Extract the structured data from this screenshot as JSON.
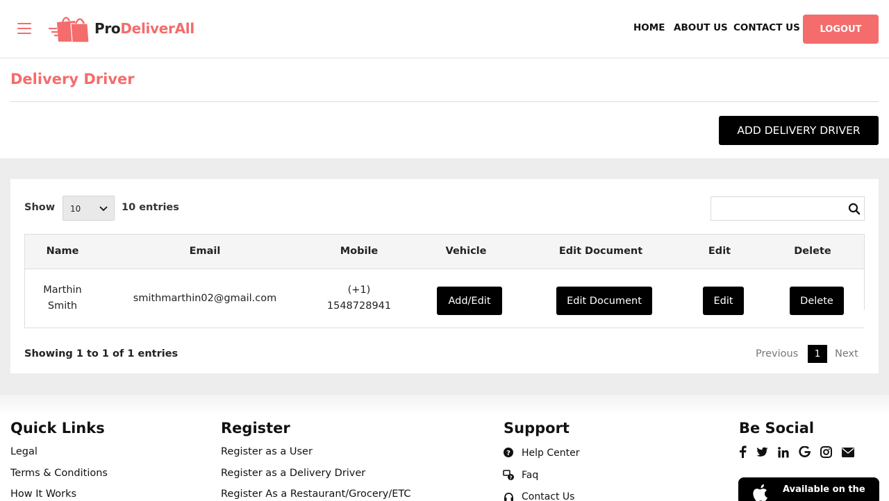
{
  "brand": {
    "name_prefix": "Pro",
    "name_suffix": "DeliverAll",
    "accent": "#f46c6c"
  },
  "nav": {
    "home": "HOME",
    "about": "ABOUT US",
    "contact": "CONTACT US",
    "logout": "LOGOUT"
  },
  "page": {
    "title": "Delivery Driver",
    "add_button": "ADD DELIVERY DRIVER"
  },
  "table_controls": {
    "show_label": "Show",
    "page_size": "10",
    "entries_label": "10 entries",
    "search_placeholder": "",
    "search_value": ""
  },
  "table": {
    "columns": [
      "Name",
      "Email",
      "Mobile",
      "Vehicle",
      "Edit Document",
      "Edit",
      "Delete"
    ],
    "rows": [
      {
        "name_first": "Marthin",
        "name_last": "Smith",
        "email": "smithmarthin02@gmail.com",
        "mobile_code": "(+1)",
        "mobile_number": "1548728941",
        "vehicle_action": "Add/Edit",
        "document_action": "Edit Document",
        "edit_action": "Edit",
        "delete_action": "Delete"
      }
    ]
  },
  "pagination": {
    "info": "Showing 1 to 1 of 1 entries",
    "previous": "Previous",
    "current": "1",
    "next": "Next"
  },
  "footer": {
    "quick_links": {
      "title": "Quick Links",
      "items": [
        "Legal",
        "Terms & Conditions",
        "How It Works"
      ]
    },
    "register": {
      "title": "Register",
      "items": [
        "Register as a User",
        "Register as a Delivery Driver",
        "Register As a Restaurant/Grocery/ETC"
      ]
    },
    "support": {
      "title": "Support",
      "items": [
        "Help Center",
        "Faq",
        "Contact Us"
      ]
    },
    "social": {
      "title": "Be Social",
      "icons": [
        "facebook-icon",
        "twitter-icon",
        "linkedin-icon",
        "google-icon",
        "instagram-icon",
        "envelope-icon"
      ]
    },
    "app_store": {
      "label": "Available on the"
    }
  }
}
